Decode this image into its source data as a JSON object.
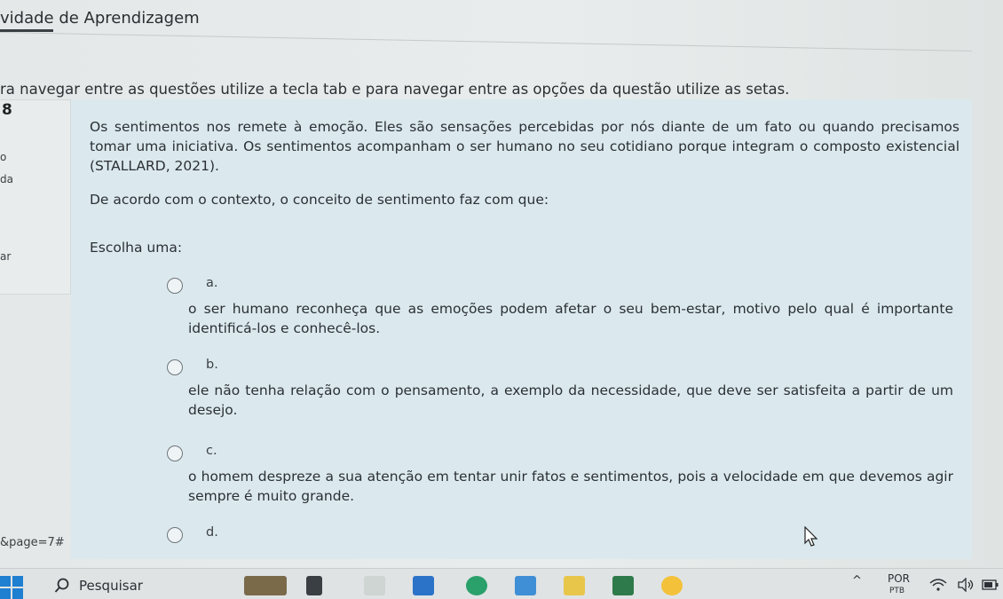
{
  "page": {
    "title": "vidade de Aprendizagem",
    "instructions": "ra navegar entre as questões utilize a tecla tab e para navegar entre as opções da questão utilize as setas."
  },
  "question_info": {
    "number": "8",
    "line1": "o",
    "line2": "da",
    "line3": "ar"
  },
  "question": {
    "paragraph1": "Os sentimentos nos remete à emoção. Eles são sensações percebidas por nós diante de um fato ou quando precisamos tomar uma iniciativa. Os sentimentos acompanham o ser humano no seu cotidiano porque integram o composto existencial (STALLARD, 2021).",
    "paragraph2": "De acordo com o contexto, o conceito de sentimento faz com que:",
    "choose_label": "Escolha uma:"
  },
  "options": [
    {
      "letter": "a.",
      "text": "o ser humano reconheça que as emoções podem afetar o seu bem-estar, motivo pelo qual é importante identificá-los e conhecê-los."
    },
    {
      "letter": "b.",
      "text": "ele não tenha relação com o pensamento, a exemplo da necessidade, que deve ser satisfeita a partir de um desejo."
    },
    {
      "letter": "c.",
      "text": "o homem despreze a sua atenção em tentar unir fatos e sentimentos, pois a velocidade em que devemos agir sempre é muito grande."
    },
    {
      "letter": "d.",
      "text": ""
    }
  ],
  "page_anchor": "&page=7#",
  "taskbar": {
    "search_label": "Pesquisar",
    "language": "POR",
    "language_sub": "PTB",
    "tray_caret": "^"
  },
  "colors": {
    "question_panel": "#dbe9ee",
    "page_bg": "#e6eaea",
    "text": "#2b3035"
  }
}
